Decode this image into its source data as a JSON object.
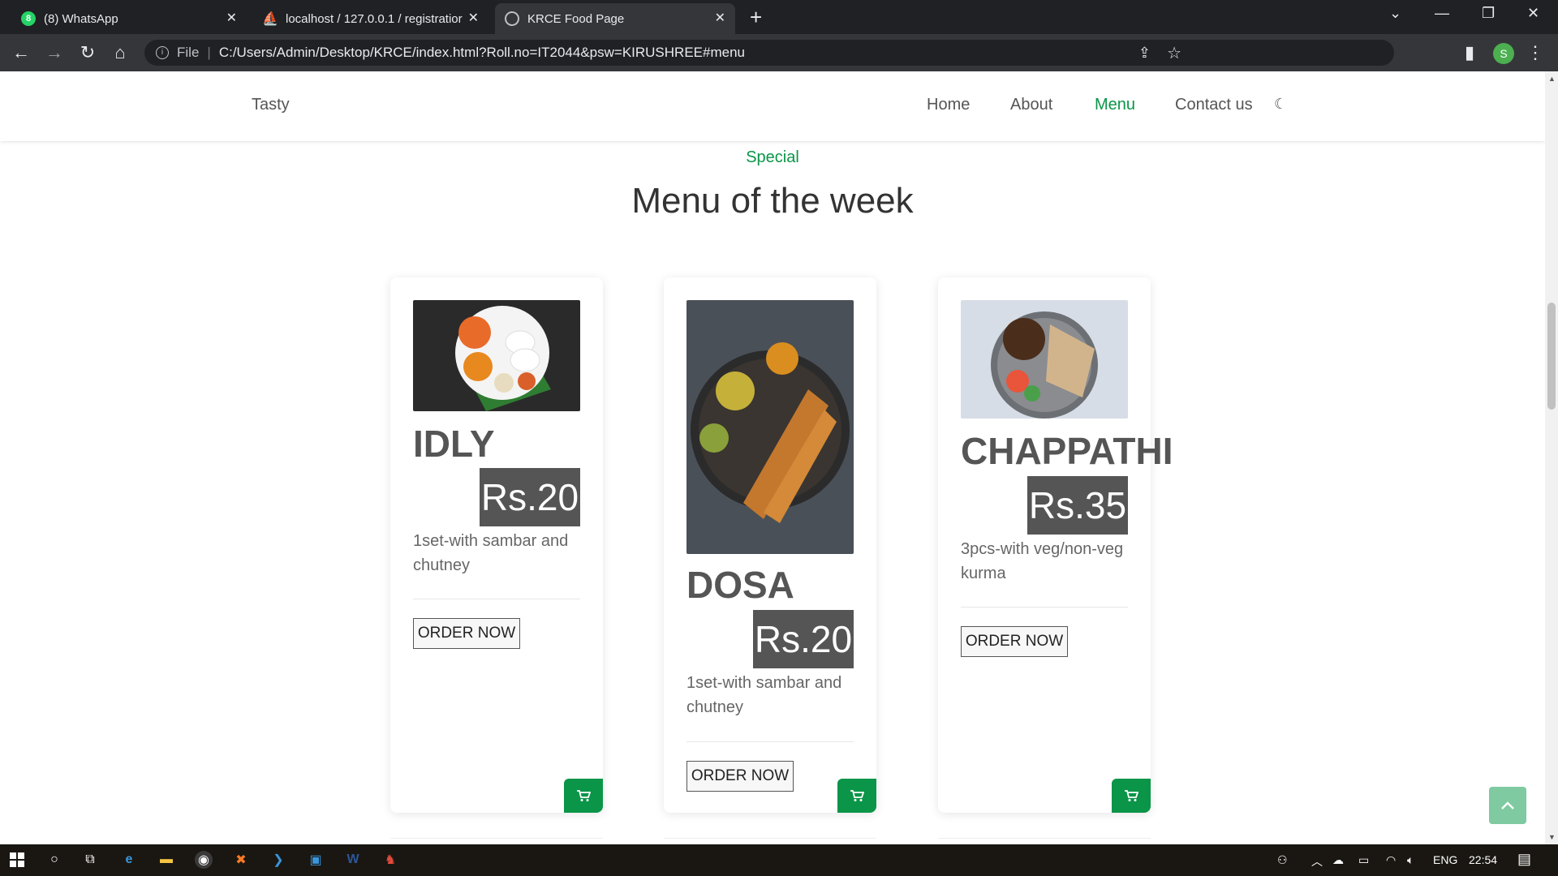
{
  "browser": {
    "tabs": [
      {
        "title": "(8) WhatsApp",
        "icon": "whatsapp-icon"
      },
      {
        "title": "localhost / 127.0.0.1 / registratior",
        "icon": "phpmyadmin-icon"
      },
      {
        "title": "KRCE Food Page",
        "icon": "globe-icon"
      }
    ],
    "url_prefix": "File",
    "url": "C:/Users/Admin/Desktop/KRCE/index.html?Roll.no=IT2044&psw=KIRUSHREE#menu",
    "profile_initial": "S"
  },
  "site": {
    "brand": "Tasty",
    "nav": [
      "Home",
      "About",
      "Menu",
      "Contact us"
    ],
    "active_nav": "Menu",
    "accent_color": "#0a9548"
  },
  "section": {
    "eyebrow": "Special",
    "title": "Menu of the week"
  },
  "menu": [
    {
      "name": "IDLY",
      "price": "Rs.20",
      "description": "1set-with sambar and chutney",
      "button": "ORDER NOW"
    },
    {
      "name": "DOSA",
      "price": "Rs.20",
      "description": "1set-with sambar and chutney",
      "button": "ORDER NOW"
    },
    {
      "name": "CHAPPATHI",
      "price": "Rs.35",
      "description": "3pcs-with veg/non-veg kurma",
      "button": "ORDER NOW"
    }
  ],
  "taskbar": {
    "language": "ENG",
    "time": "22:54"
  }
}
